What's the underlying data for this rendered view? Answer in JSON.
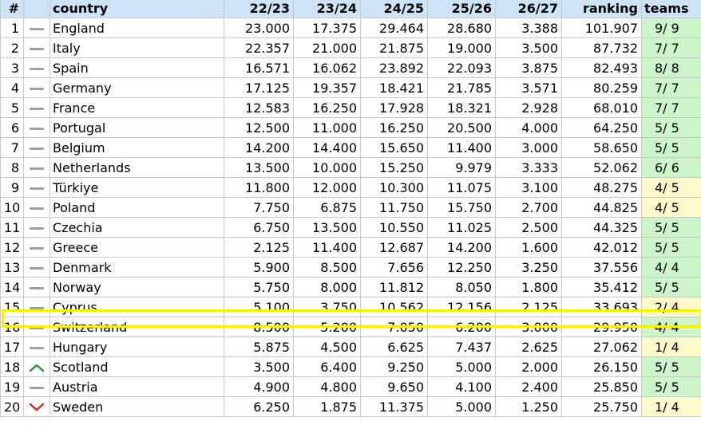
{
  "table": {
    "headers": {
      "rank": "#",
      "trend": "",
      "country": "country",
      "y1": "22/23",
      "y2": "23/24",
      "y3": "24/25",
      "y4": "25/26",
      "y5": "26/27",
      "ranking": "ranking",
      "teams": "teams"
    },
    "rows": [
      {
        "rank": "1",
        "trend": "same",
        "country": "England",
        "y1": "23.000",
        "y2": "17.375",
        "y3": "29.464",
        "y4": "28.680",
        "y5": "3.388",
        "ranking": "101.907",
        "teams": "9/ 9",
        "teams_status": "green"
      },
      {
        "rank": "2",
        "trend": "same",
        "country": "Italy",
        "y1": "22.357",
        "y2": "21.000",
        "y3": "21.875",
        "y4": "19.000",
        "y5": "3.500",
        "ranking": "87.732",
        "teams": "7/ 7",
        "teams_status": "green"
      },
      {
        "rank": "3",
        "trend": "same",
        "country": "Spain",
        "y1": "16.571",
        "y2": "16.062",
        "y3": "23.892",
        "y4": "22.093",
        "y5": "3.875",
        "ranking": "82.493",
        "teams": "8/ 8",
        "teams_status": "green"
      },
      {
        "rank": "4",
        "trend": "same",
        "country": "Germany",
        "y1": "17.125",
        "y2": "19.357",
        "y3": "18.421",
        "y4": "21.785",
        "y5": "3.571",
        "ranking": "80.259",
        "teams": "7/ 7",
        "teams_status": "green"
      },
      {
        "rank": "5",
        "trend": "same",
        "country": "France",
        "y1": "12.583",
        "y2": "16.250",
        "y3": "17.928",
        "y4": "18.321",
        "y5": "2.928",
        "ranking": "68.010",
        "teams": "7/ 7",
        "teams_status": "green"
      },
      {
        "rank": "6",
        "trend": "same",
        "country": "Portugal",
        "y1": "12.500",
        "y2": "11.000",
        "y3": "16.250",
        "y4": "20.500",
        "y5": "4.000",
        "ranking": "64.250",
        "teams": "5/ 5",
        "teams_status": "green"
      },
      {
        "rank": "7",
        "trend": "same",
        "country": "Belgium",
        "y1": "14.200",
        "y2": "14.400",
        "y3": "15.650",
        "y4": "11.400",
        "y5": "3.000",
        "ranking": "58.650",
        "teams": "5/ 5",
        "teams_status": "green"
      },
      {
        "rank": "8",
        "trend": "same",
        "country": "Netherlands",
        "y1": "13.500",
        "y2": "10.000",
        "y3": "15.250",
        "y4": "9.979",
        "y5": "3.333",
        "ranking": "52.062",
        "teams": "6/ 6",
        "teams_status": "green"
      },
      {
        "rank": "9",
        "trend": "same",
        "country": "Türkiye",
        "y1": "11.800",
        "y2": "12.000",
        "y3": "10.300",
        "y4": "11.075",
        "y5": "3.100",
        "ranking": "48.275",
        "teams": "4/ 5",
        "teams_status": "yellow"
      },
      {
        "rank": "10",
        "trend": "same",
        "country": "Poland",
        "y1": "7.750",
        "y2": "6.875",
        "y3": "11.750",
        "y4": "15.750",
        "y5": "2.700",
        "ranking": "44.825",
        "teams": "4/ 5",
        "teams_status": "yellow"
      },
      {
        "rank": "11",
        "trend": "same",
        "country": "Czechia",
        "y1": "6.750",
        "y2": "13.500",
        "y3": "10.550",
        "y4": "11.025",
        "y5": "2.500",
        "ranking": "44.325",
        "teams": "5/ 5",
        "teams_status": "green"
      },
      {
        "rank": "12",
        "trend": "same",
        "country": "Greece",
        "y1": "2.125",
        "y2": "11.400",
        "y3": "12.687",
        "y4": "14.200",
        "y5": "1.600",
        "ranking": "42.012",
        "teams": "5/ 5",
        "teams_status": "green"
      },
      {
        "rank": "13",
        "trend": "same",
        "country": "Denmark",
        "y1": "5.900",
        "y2": "8.500",
        "y3": "7.656",
        "y4": "12.250",
        "y5": "3.250",
        "ranking": "37.556",
        "teams": "4/ 4",
        "teams_status": "green"
      },
      {
        "rank": "14",
        "trend": "same",
        "country": "Norway",
        "y1": "5.750",
        "y2": "8.000",
        "y3": "11.812",
        "y4": "8.050",
        "y5": "1.800",
        "ranking": "35.412",
        "teams": "5/ 5",
        "teams_status": "green"
      },
      {
        "rank": "15",
        "trend": "same",
        "country": "Cyprus",
        "y1": "5.100",
        "y2": "3.750",
        "y3": "10.562",
        "y4": "12.156",
        "y5": "2.125",
        "ranking": "33.693",
        "teams": "2/ 4",
        "teams_status": "yellow"
      },
      {
        "rank": "16",
        "trend": "same",
        "country": "Switzerland",
        "y1": "8.500",
        "y2": "5.200",
        "y3": "7.050",
        "y4": "6.200",
        "y5": "3.000",
        "ranking": "29.950",
        "teams": "4/ 4",
        "teams_status": "green"
      },
      {
        "rank": "17",
        "trend": "same",
        "country": "Hungary",
        "y1": "5.875",
        "y2": "4.500",
        "y3": "6.625",
        "y4": "7.437",
        "y5": "2.625",
        "ranking": "27.062",
        "teams": "1/ 4",
        "teams_status": "yellow"
      },
      {
        "rank": "18",
        "trend": "up",
        "country": "Scotland",
        "y1": "3.500",
        "y2": "6.400",
        "y3": "9.250",
        "y4": "5.000",
        "y5": "2.000",
        "ranking": "26.150",
        "teams": "5/ 5",
        "teams_status": "green"
      },
      {
        "rank": "19",
        "trend": "same",
        "country": "Austria",
        "y1": "4.900",
        "y2": "4.800",
        "y3": "9.650",
        "y4": "4.100",
        "y5": "2.400",
        "ranking": "25.850",
        "teams": "5/ 5",
        "teams_status": "green"
      },
      {
        "rank": "20",
        "trend": "down",
        "country": "Sweden",
        "y1": "6.250",
        "y2": "1.875",
        "y3": "11.375",
        "y4": "5.000",
        "y5": "1.250",
        "ranking": "25.750",
        "teams": "1/ 4",
        "teams_status": "yellow"
      }
    ],
    "highlighted_rank": "15",
    "colors": {
      "header_bg": "#cfe3f7",
      "teams_green": "#ccf5cc",
      "teams_yellow": "#fffacc",
      "highlight_border": "#ffef00",
      "trend_up": "#2e9e2e",
      "trend_down": "#d03030",
      "trend_same": "#a0a0a0"
    }
  }
}
